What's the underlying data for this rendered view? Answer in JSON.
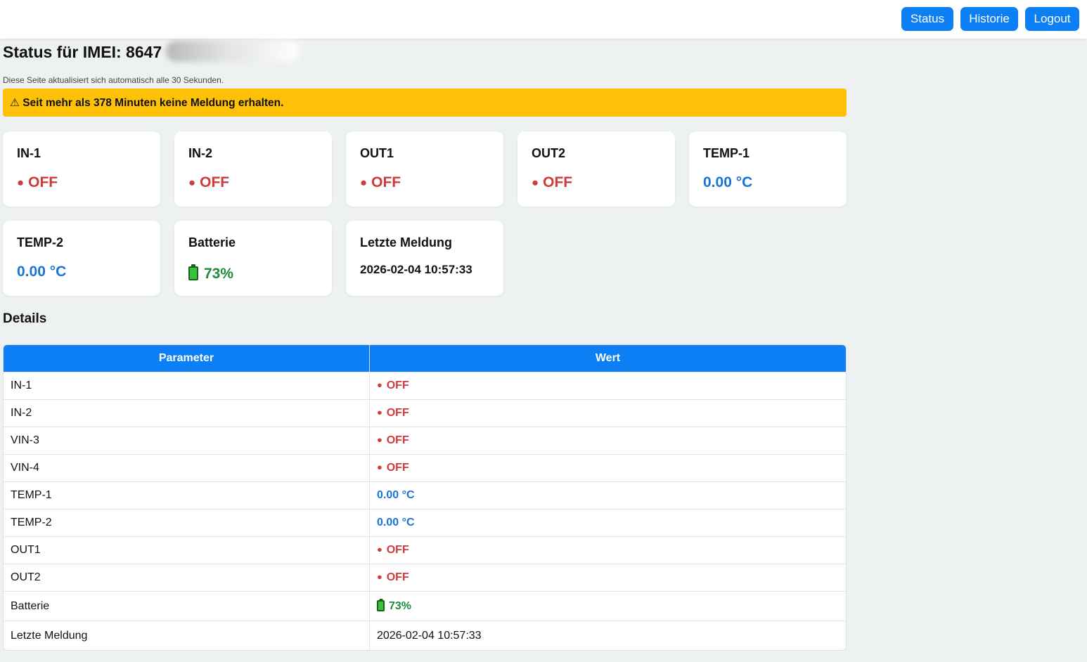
{
  "nav": {
    "status_label": "Status",
    "history_label": "Historie",
    "logout_label": "Logout"
  },
  "header": {
    "title_prefix": "Status für IMEI: 8647",
    "subtitle": "Diese Seite aktualisiert sich automatisch alle 30 Sekunden."
  },
  "alert": {
    "icon": "warning-icon",
    "symbol": "⚠",
    "text": "Seit mehr als 378 Minuten keine Meldung erhalten.",
    "color": "#ffc107"
  },
  "cards": [
    {
      "label": "IN-1",
      "value": "OFF",
      "kind": "off"
    },
    {
      "label": "IN-2",
      "value": "OFF",
      "kind": "off"
    },
    {
      "label": "OUT1",
      "value": "OFF",
      "kind": "off"
    },
    {
      "label": "OUT2",
      "value": "OFF",
      "kind": "off"
    },
    {
      "label": "TEMP-1",
      "value": "0.00 °C",
      "kind": "temp"
    },
    {
      "label": "TEMP-2",
      "value": "0.00 °C",
      "kind": "temp"
    },
    {
      "label": "Batterie",
      "value": "73%",
      "kind": "battery"
    },
    {
      "label": "Letzte Meldung",
      "value": "2026-02-04 10:57:33",
      "kind": "timestamp"
    }
  ],
  "details": {
    "heading": "Details",
    "columns": [
      "Parameter",
      "Wert"
    ],
    "rows": [
      {
        "param": "IN-1",
        "value": "OFF",
        "kind": "off"
      },
      {
        "param": "IN-2",
        "value": "OFF",
        "kind": "off"
      },
      {
        "param": "VIN-3",
        "value": "OFF",
        "kind": "off"
      },
      {
        "param": "VIN-4",
        "value": "OFF",
        "kind": "off"
      },
      {
        "param": "TEMP-1",
        "value": "0.00 °C",
        "kind": "temp"
      },
      {
        "param": "TEMP-2",
        "value": "0.00 °C",
        "kind": "temp"
      },
      {
        "param": "OUT1",
        "value": "OFF",
        "kind": "off"
      },
      {
        "param": "OUT2",
        "value": "OFF",
        "kind": "off"
      },
      {
        "param": "Batterie",
        "value": "73%",
        "kind": "battery"
      },
      {
        "param": "Letzte Meldung",
        "value": "2026-02-04 10:57:33",
        "kind": "timestamp"
      }
    ]
  },
  "colors": {
    "accent": "#0d7ff5",
    "off": "#d13a3a",
    "temp": "#1a73d6",
    "battery": "#1f8a3e",
    "background": "#eef1f2"
  },
  "icons": {
    "status_dot": "red-dot-icon",
    "battery": "battery-icon",
    "dot_glyph": "●"
  }
}
